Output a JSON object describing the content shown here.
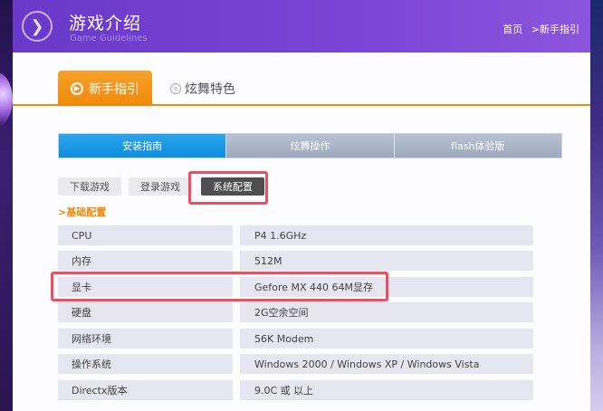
{
  "header": {
    "title": "游戏介绍",
    "subtitle": "Game Guidelines",
    "breadcrumb_home": "首页",
    "breadcrumb_current": ">新手指引",
    "icon": "chevron-circle-icon"
  },
  "tabs": [
    {
      "label": "新手指引",
      "active": true,
      "icon": "play-circle-icon"
    },
    {
      "label": "炫舞特色",
      "active": false,
      "icon": "list-circle-icon"
    }
  ],
  "subnav": [
    "安装指南",
    "炫舞操作",
    "flash体验版"
  ],
  "pills": [
    {
      "label": "下载游戏",
      "active": false
    },
    {
      "label": "登录游戏",
      "active": false
    },
    {
      "label": "系统配置",
      "active": true
    }
  ],
  "section_title": ">基础配置",
  "specs": [
    {
      "label": "CPU",
      "value": "P4 1.6GHz"
    },
    {
      "label": "内存",
      "value": "512M"
    },
    {
      "label": "显卡",
      "value": "Gefore MX 440 64M显存"
    },
    {
      "label": "硬盘",
      "value": "2G空余空间"
    },
    {
      "label": "网络环境",
      "value": "56K Modem"
    },
    {
      "label": "操作系统",
      "value": "Windows 2000 / Windows XP / Windows Vista"
    },
    {
      "label": "Directx版本",
      "value": "9.0C 或 以上"
    }
  ],
  "colors": {
    "header_purple": "#7b44d6",
    "accent_orange": "#f08a0a",
    "subnav_blue": "#1a96e4",
    "highlight_red": "#f04e5e"
  }
}
